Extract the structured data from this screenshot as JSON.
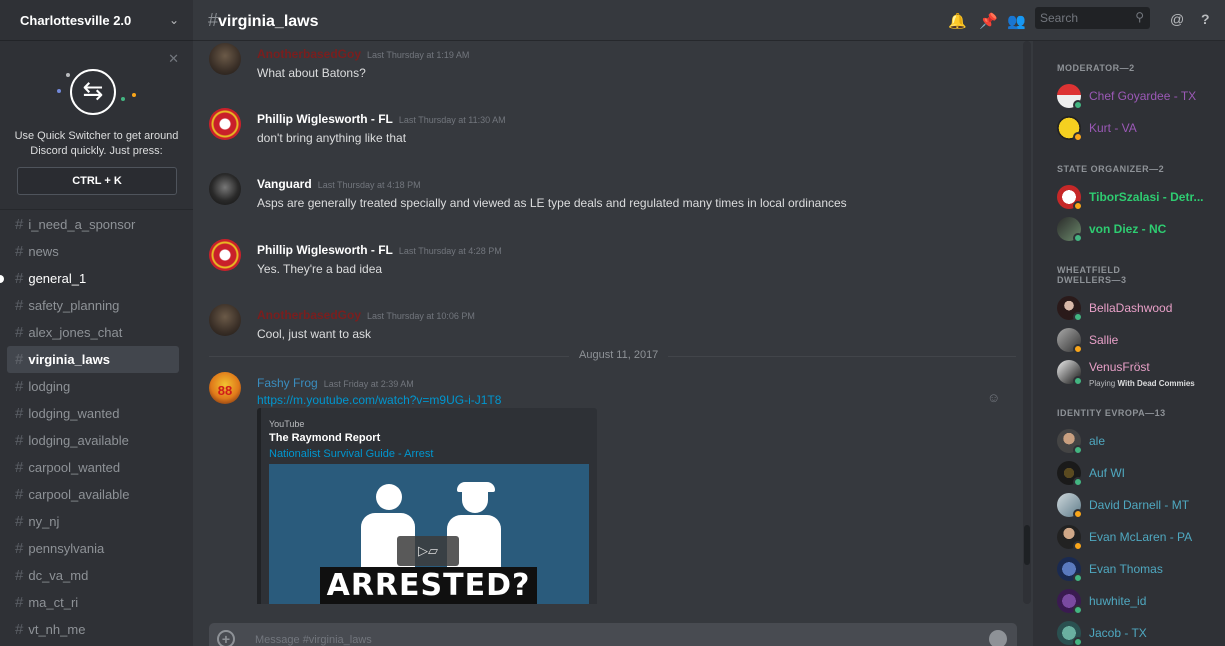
{
  "server": {
    "name": "Charlottesville 2.0"
  },
  "quick_switcher": {
    "text_line1": "Use Quick Switcher to get around",
    "text_line2": "Discord quickly. Just press:",
    "shortcut": "CTRL + K"
  },
  "channels": [
    {
      "name": "i_need_a_sponsor",
      "state": "normal"
    },
    {
      "name": "news",
      "state": "normal"
    },
    {
      "name": "general_1",
      "state": "unread"
    },
    {
      "name": "safety_planning",
      "state": "normal"
    },
    {
      "name": "alex_jones_chat",
      "state": "normal"
    },
    {
      "name": "virginia_laws",
      "state": "active"
    },
    {
      "name": "lodging",
      "state": "normal"
    },
    {
      "name": "lodging_wanted",
      "state": "normal"
    },
    {
      "name": "lodging_available",
      "state": "normal"
    },
    {
      "name": "carpool_wanted",
      "state": "normal"
    },
    {
      "name": "carpool_available",
      "state": "normal"
    },
    {
      "name": "ny_nj",
      "state": "normal"
    },
    {
      "name": "pennsylvania",
      "state": "normal"
    },
    {
      "name": "dc_va_md",
      "state": "normal"
    },
    {
      "name": "ma_ct_ri",
      "state": "normal"
    },
    {
      "name": "vt_nh_me",
      "state": "normal"
    }
  ],
  "header": {
    "hash": "#",
    "channel": "virginia_laws",
    "search_placeholder": "Search",
    "at_icon": "@",
    "help_icon": "?"
  },
  "messages": [
    {
      "author": "AnotherbasedGoy",
      "color": "#7a1e1e",
      "time": "Last Thursday at 1:19 AM",
      "text": "What about Batons?",
      "avatar": "dark-face"
    },
    {
      "author": "Phillip Wiglesworth - FL",
      "color": "#ffffff",
      "time": "Last Thursday at 11:30 AM",
      "text": "don't bring anything like that",
      "avatar": "chiefs-logo"
    },
    {
      "author": "Vanguard",
      "color": "#ffffff",
      "time": "Last Thursday at 4:18 PM",
      "text": "Asps are generally treated specially and viewed as LE type deals and regulated many times in local ordinances",
      "avatar": "soldier"
    },
    {
      "author": "Phillip Wiglesworth - FL",
      "color": "#ffffff",
      "time": "Last Thursday at 4:28 PM",
      "text": "Yes. They're a bad idea",
      "avatar": "chiefs-logo"
    },
    {
      "author": "AnotherbasedGoy",
      "color": "#7a1e1e",
      "time": "Last Thursday at 10:06 PM",
      "text": "Cool,  just want to ask",
      "avatar": "dark-face"
    }
  ],
  "date_divider": "August 11, 2017",
  "last_message": {
    "author": "Fashy Frog",
    "color": "#3a8dbf",
    "time": "Last Friday at 2:39 AM",
    "link": "https://m.youtube.com/watch?v=m9UG-i-J1T8",
    "avatar": "frog-88",
    "avatar_text": "88"
  },
  "embed": {
    "provider": "YouTube",
    "title": "The Raymond Report",
    "link_title": "Nationalist Survival Guide - Arrest",
    "thumbnail_text": "ARRESTED?"
  },
  "chatbox": {
    "placeholder": "Message #virginia_laws"
  },
  "members": {
    "groups": [
      {
        "title": "MODERATOR—2",
        "members": [
          {
            "name": "Chef Goyardee - TX",
            "color": "#9b59b6",
            "bold": false,
            "status": "online",
            "avatar": "can"
          },
          {
            "name": "Kurt - VA",
            "color": "#9b59b6",
            "bold": false,
            "status": "idle",
            "avatar": "sunglasses"
          }
        ]
      },
      {
        "title": "STATE ORGANIZER—2",
        "members": [
          {
            "name": "TiborSzalasi - Detr...",
            "color": "#2ecc71",
            "bold": true,
            "status": "idle",
            "avatar": "wings"
          },
          {
            "name": "von Diez - NC",
            "color": "#2ecc71",
            "bold": true,
            "status": "online",
            "avatar": "figure"
          }
        ]
      },
      {
        "title": "WHEATFIELD DWELLERS—3",
        "members": [
          {
            "name": "BellaDashwood",
            "color": "#e8a0c8",
            "bold": false,
            "status": "online",
            "avatar": "woman"
          },
          {
            "name": "Sallie",
            "color": "#e8a0c8",
            "bold": false,
            "status": "idle",
            "avatar": "photo"
          },
          {
            "name": "VenusFröst",
            "color": "#e8a0c8",
            "bold": false,
            "status": "online",
            "avatar": "bw",
            "activity_prefix": "Playing",
            "activity": "With Dead Commies"
          }
        ]
      },
      {
        "title": "IDENTITY EVROPA—13",
        "members": [
          {
            "name": "ale",
            "color": "#4fa8c0",
            "bold": false,
            "status": "online",
            "avatar": "man"
          },
          {
            "name": "Auf WI",
            "color": "#4fa8c0",
            "bold": false,
            "status": "online",
            "avatar": "dark"
          },
          {
            "name": "David Darnell - MT",
            "color": "#4fa8c0",
            "bold": false,
            "status": "idle",
            "avatar": "light"
          },
          {
            "name": "Evan McLaren - PA",
            "color": "#4fa8c0",
            "bold": false,
            "status": "idle",
            "avatar": "suit"
          },
          {
            "name": "Evan Thomas",
            "color": "#4fa8c0",
            "bold": false,
            "status": "online",
            "avatar": "blue"
          },
          {
            "name": "huwhite_id",
            "color": "#4fa8c0",
            "bold": false,
            "status": "online",
            "avatar": "purple"
          },
          {
            "name": "Jacob - TX",
            "color": "#4fa8c0",
            "bold": false,
            "status": "online",
            "avatar": "teal"
          }
        ]
      }
    ]
  },
  "colors": {
    "online": "#43b581",
    "idle": "#faa61a",
    "link": "#0096cf",
    "background": "#36393e",
    "sidebar": "#2f3136"
  }
}
